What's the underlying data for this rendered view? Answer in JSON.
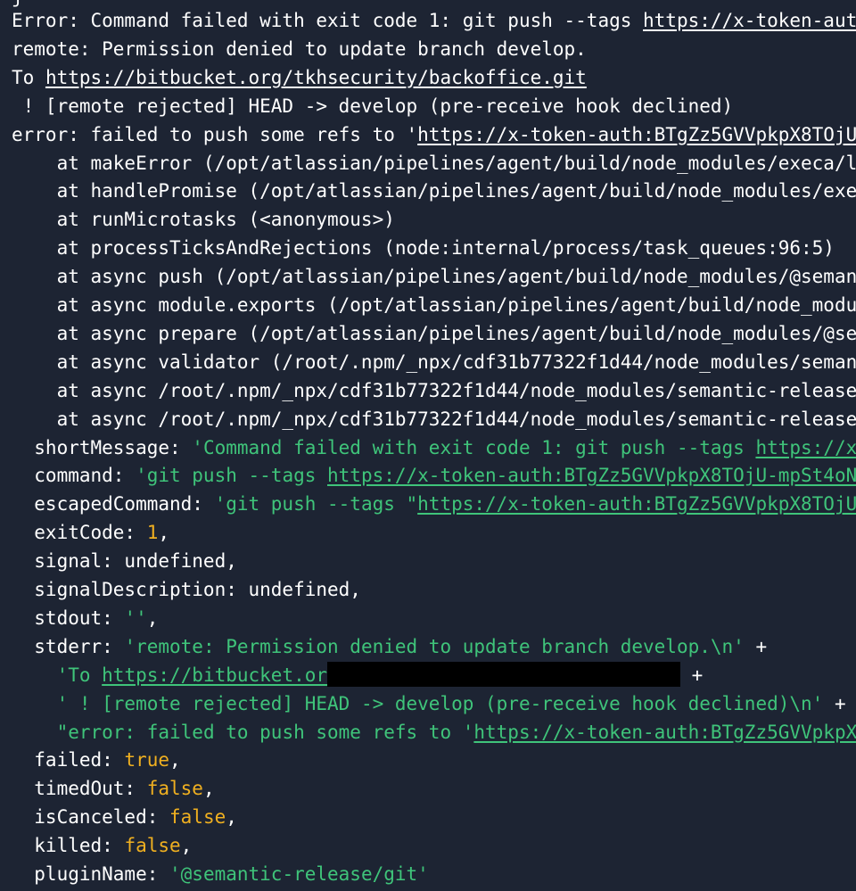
{
  "terminal": {
    "lines": [
      [
        {
          "t": "Error: Command failed with exit code 1: git push --tags ",
          "c": "white"
        },
        {
          "t": "https://x-token-auth:BTgZz5GVVpkpX8TOjU",
          "c": "white",
          "link": true
        }
      ],
      [
        {
          "t": "remote: Permission denied to update branch develop.",
          "c": "white"
        }
      ],
      [
        {
          "t": "To ",
          "c": "white"
        },
        {
          "t": "https://bitbucket.org/tkhsecurity/backoffice.git",
          "c": "white",
          "link": true
        }
      ],
      [
        {
          "t": " ! [remote rejected] HEAD -> develop (pre-receive hook declined)",
          "c": "white"
        }
      ],
      [
        {
          "t": "error: failed to push some refs to '",
          "c": "white"
        },
        {
          "t": "https://x-token-auth:BTgZz5GVVpkpX8TOjU",
          "c": "white",
          "link": true
        }
      ],
      [
        {
          "t": "    at makeError (/opt/atlassian/pipelines/agent/build/node_modules/execa/l",
          "c": "white"
        }
      ],
      [
        {
          "t": "    at handlePromise (/opt/atlassian/pipelines/agent/build/node_modules/exe",
          "c": "white"
        }
      ],
      [
        {
          "t": "    at runMicrotasks (<anonymous>)",
          "c": "white"
        }
      ],
      [
        {
          "t": "    at processTicksAndRejections (node:internal/process/task_queues:96:5)",
          "c": "white"
        }
      ],
      [
        {
          "t": "    at async push (/opt/atlassian/pipelines/agent/build/node_modules/@seman",
          "c": "white"
        }
      ],
      [
        {
          "t": "    at async module.exports (/opt/atlassian/pipelines/agent/build/node_modu",
          "c": "white"
        }
      ],
      [
        {
          "t": "    at async prepare (/opt/atlassian/pipelines/agent/build/node_modules/@se",
          "c": "white"
        }
      ],
      [
        {
          "t": "    at async validator (/root/.npm/_npx/cdf31b77322f1d44/node_modules/seman",
          "c": "white"
        }
      ],
      [
        {
          "t": "    at async /root/.npm/_npx/cdf31b77322f1d44/node_modules/semantic-release",
          "c": "white"
        }
      ],
      [
        {
          "t": "    at async /root/.npm/_npx/cdf31b77322f1d44/node_modules/semantic-release",
          "c": "white"
        }
      ],
      [
        {
          "t": "  shortMessage: ",
          "c": "white"
        },
        {
          "t": "'Command failed with exit code 1: git push --tags ",
          "c": "green"
        },
        {
          "t": "https://x",
          "c": "green",
          "link": true
        }
      ],
      [
        {
          "t": "  command: ",
          "c": "white"
        },
        {
          "t": "'git push --tags ",
          "c": "green"
        },
        {
          "t": "https://x-token-auth:BTgZz5GVVpkpX8TOjU-mpSt4oN",
          "c": "green",
          "link": true
        }
      ],
      [
        {
          "t": "  escapedCommand: ",
          "c": "white"
        },
        {
          "t": "'git push --tags \"",
          "c": "green"
        },
        {
          "t": "https://x-token-auth:BTgZz5GVVpkpX8TOjU",
          "c": "green",
          "link": true
        }
      ],
      [
        {
          "t": "  exitCode: ",
          "c": "white"
        },
        {
          "t": "1",
          "c": "orange"
        },
        {
          "t": ",",
          "c": "white"
        }
      ],
      [
        {
          "t": "  signal: undefined,",
          "c": "white"
        }
      ],
      [
        {
          "t": "  signalDescription: undefined,",
          "c": "white"
        }
      ],
      [
        {
          "t": "  stdout: ",
          "c": "white"
        },
        {
          "t": "''",
          "c": "green"
        },
        {
          "t": ",",
          "c": "white"
        }
      ],
      [
        {
          "t": "  stderr: ",
          "c": "white"
        },
        {
          "t": "'remote: Permission denied to update branch develop.\\n'",
          "c": "green"
        },
        {
          "t": " +",
          "c": "white"
        }
      ],
      [
        {
          "t": "    ",
          "c": "white"
        },
        {
          "t": "'To ",
          "c": "green"
        },
        {
          "t": "https://bitbucket.or",
          "c": "green",
          "link": true
        },
        {
          "t": "",
          "c": "white",
          "redact": true
        },
        {
          "t": " +",
          "c": "white"
        }
      ],
      [
        {
          "t": "    ",
          "c": "white"
        },
        {
          "t": "' ! [remote rejected] HEAD -> develop (pre-receive hook declined)\\n'",
          "c": "green"
        },
        {
          "t": " +",
          "c": "white"
        }
      ],
      [
        {
          "t": "    ",
          "c": "white"
        },
        {
          "t": "\"error: failed to push some refs to '",
          "c": "green"
        },
        {
          "t": "https://x-token-auth:BTgZz5GVVpkpX",
          "c": "green",
          "link": true
        }
      ],
      [
        {
          "t": "  failed: ",
          "c": "white"
        },
        {
          "t": "true",
          "c": "orange"
        },
        {
          "t": ",",
          "c": "white"
        }
      ],
      [
        {
          "t": "  timedOut: ",
          "c": "white"
        },
        {
          "t": "false",
          "c": "orange"
        },
        {
          "t": ",",
          "c": "white"
        }
      ],
      [
        {
          "t": "  isCanceled: ",
          "c": "white"
        },
        {
          "t": "false",
          "c": "orange"
        },
        {
          "t": ",",
          "c": "white"
        }
      ],
      [
        {
          "t": "  killed: ",
          "c": "white"
        },
        {
          "t": "false",
          "c": "orange"
        },
        {
          "t": ",",
          "c": "white"
        }
      ],
      [
        {
          "t": "  pluginName: ",
          "c": "white"
        },
        {
          "t": "'@semantic-release/git'",
          "c": "green"
        }
      ]
    ]
  },
  "colors": {
    "background": "#1d2433",
    "text": "#ffffff",
    "string": "#3fc47a",
    "literal": "#f0b020",
    "redaction": "#000000"
  }
}
